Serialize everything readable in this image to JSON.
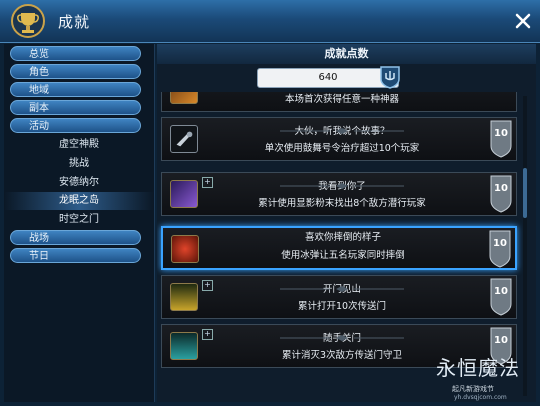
{
  "window": {
    "title": "成就"
  },
  "sidebar": {
    "categories": [
      {
        "label": "总览"
      },
      {
        "label": "角色"
      },
      {
        "label": "地域"
      },
      {
        "label": "副本"
      },
      {
        "label": "活动"
      },
      {
        "label": "战场"
      },
      {
        "label": "节日"
      }
    ],
    "activity_items": [
      {
        "label": "虚空神殿"
      },
      {
        "label": "挑战"
      },
      {
        "label": "安德纳尔"
      },
      {
        "label": "龙眠之岛"
      },
      {
        "label": "时空之门"
      }
    ]
  },
  "main": {
    "header": "成就点数",
    "points": "640",
    "cards": [
      {
        "title": "",
        "desc": "本场首次获得任意一种神器",
        "points": ""
      },
      {
        "title": "大伙，听我说个故事？",
        "desc": "单次使用鼓舞号令治疗超过10个玩家",
        "points": "10"
      },
      {
        "title": "我看到你了",
        "desc": "累计使用显影粉末找出8个敌方潜行玩家",
        "points": "10"
      },
      {
        "title": "喜欢你摔倒的样子",
        "desc": "使用冰弹让五名玩家同时摔倒",
        "points": "10"
      },
      {
        "title": "开门见山",
        "desc": "累计打开10次传送门",
        "points": "10"
      },
      {
        "title": "随手关门",
        "desc": "累计消灭3次敌方传送门守卫",
        "points": "10"
      }
    ]
  },
  "watermark": {
    "logo": "永恒魔法",
    "sub": "起凡新游戏节",
    "url": "yh.dvsqjcom.com"
  },
  "colors": {
    "accent": "#3aa3ff",
    "title_bar": "#1b4a78",
    "card_bg": "#14171c"
  }
}
